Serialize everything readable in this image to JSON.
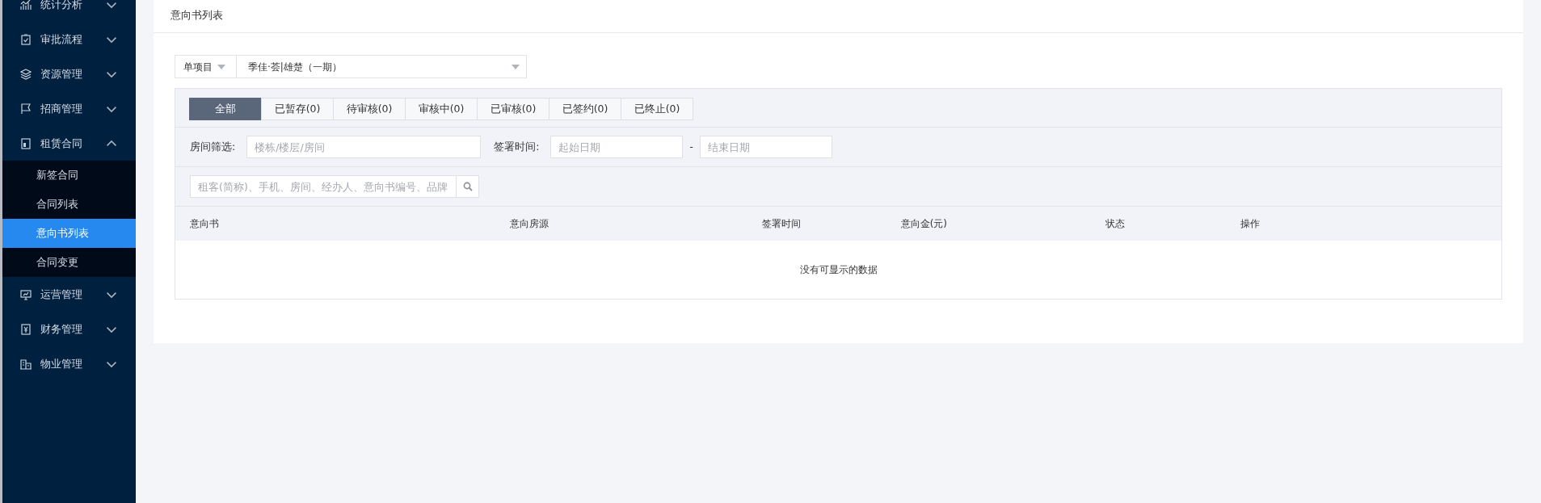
{
  "sidebar": {
    "items": [
      {
        "label": "统计分析",
        "expanded": false
      },
      {
        "label": "审批流程",
        "expanded": false
      },
      {
        "label": "资源管理",
        "expanded": false
      },
      {
        "label": "招商管理",
        "expanded": false
      },
      {
        "label": "租赁合同",
        "expanded": true,
        "children": [
          {
            "label": "新签合同",
            "selected": false
          },
          {
            "label": "合同列表",
            "selected": false
          },
          {
            "label": "意向书列表",
            "selected": true
          },
          {
            "label": "合同变更",
            "selected": false
          }
        ]
      },
      {
        "label": "运营管理",
        "expanded": false
      },
      {
        "label": "财务管理",
        "expanded": false
      },
      {
        "label": "物业管理",
        "expanded": false
      }
    ]
  },
  "page_title": "意向书列表",
  "project_select": {
    "scope": "单项目",
    "project": "季佳·荟|雄楚（一期）"
  },
  "tabs": [
    {
      "label": "全部",
      "selected": true
    },
    {
      "label": "已暂存(0)",
      "selected": false
    },
    {
      "label": "待审核(0)",
      "selected": false
    },
    {
      "label": "审核中(0)",
      "selected": false
    },
    {
      "label": "已审核(0)",
      "selected": false
    },
    {
      "label": "已签约(0)",
      "selected": false
    },
    {
      "label": "已终止(0)",
      "selected": false
    }
  ],
  "filters": {
    "room_label": "房间筛选:",
    "room_placeholder": "楼栋/楼层/房间",
    "date_label": "签署时间:",
    "start_placeholder": "起始日期",
    "separator": "-",
    "end_placeholder": "结束日期"
  },
  "search": {
    "placeholder": "租客(简称)、手机、房间、经办人、意向书编号、品牌"
  },
  "table": {
    "columns": [
      "意向书",
      "意向房源",
      "签署时间",
      "意向金(元)",
      "状态",
      "操作"
    ],
    "empty_text": "没有可显示的数据"
  }
}
